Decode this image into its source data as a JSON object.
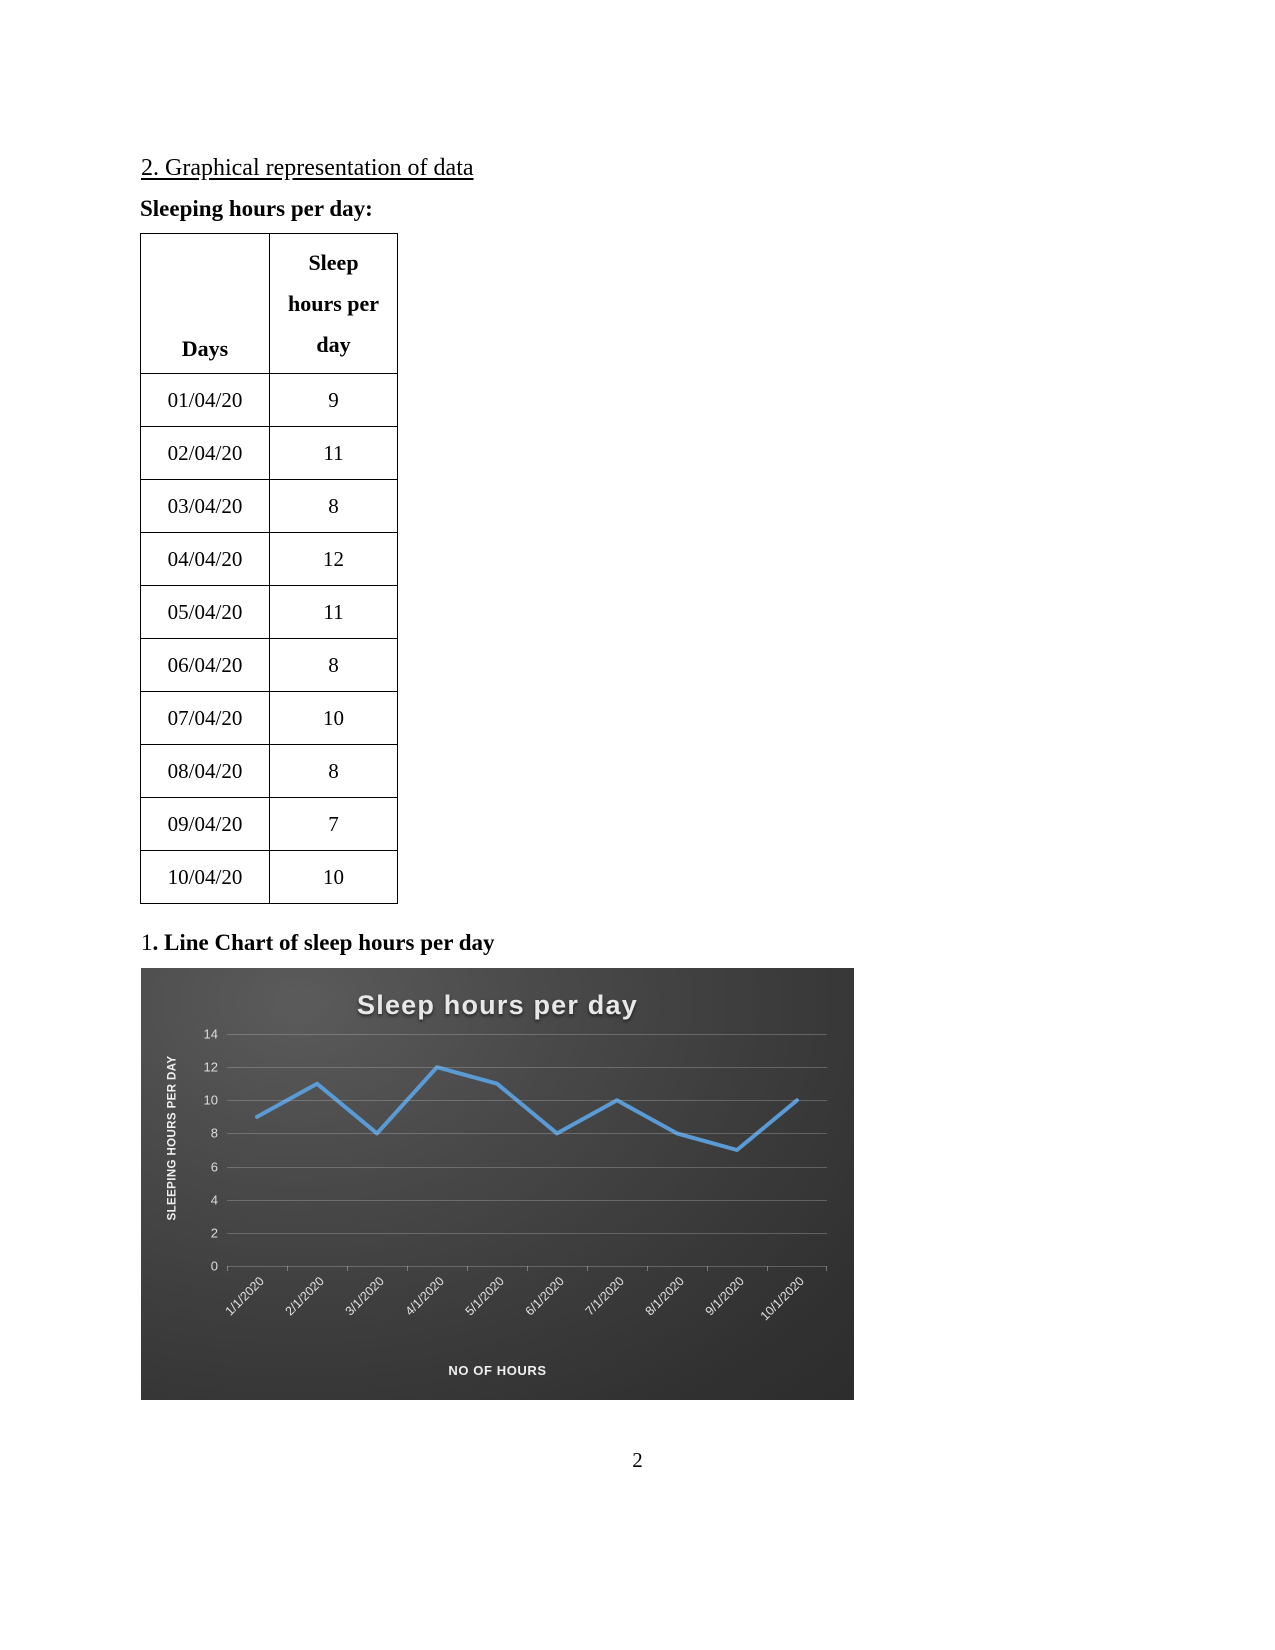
{
  "document": {
    "heading": "2. Graphical representation of data",
    "subheading": "Sleeping hours per day:",
    "page_number": "2"
  },
  "table": {
    "headers": [
      "Days",
      "Sleep hours per day"
    ],
    "header_days": "Days",
    "header_hours_line1": "Sleep",
    "header_hours_line2": "hours per",
    "header_hours_line3": "day",
    "rows": [
      {
        "day": "01/04/20",
        "hours": "9"
      },
      {
        "day": "02/04/20",
        "hours": "11"
      },
      {
        "day": "03/04/20",
        "hours": "8"
      },
      {
        "day": "04/04/20",
        "hours": "12"
      },
      {
        "day": "05/04/20",
        "hours": "11"
      },
      {
        "day": "06/04/20",
        "hours": "8"
      },
      {
        "day": "07/04/20",
        "hours": "10"
      },
      {
        "day": "08/04/20",
        "hours": "8"
      },
      {
        "day": "09/04/20",
        "hours": "7"
      },
      {
        "day": "10/04/20",
        "hours": "10"
      }
    ]
  },
  "chart_caption": {
    "number": "1",
    "text": ". Line Chart of sleep hours per day"
  },
  "chart_data": {
    "type": "line",
    "title": "Sleep hours per day",
    "xlabel": "NO OF HOURS",
    "ylabel": "SLEEPING HOURS PER DAY",
    "categories": [
      "1/1/2020",
      "2/1/2020",
      "3/1/2020",
      "4/1/2020",
      "5/1/2020",
      "6/1/2020",
      "7/1/2020",
      "8/1/2020",
      "9/1/2020",
      "10/1/2020"
    ],
    "values": [
      9,
      11,
      8,
      12,
      11,
      8,
      10,
      8,
      7,
      10
    ],
    "yticks": [
      14,
      12,
      10,
      8,
      6,
      4,
      2,
      0
    ],
    "ylim": [
      0,
      14
    ],
    "grid": true,
    "legend": "none",
    "line_color": "#5b9bd5",
    "background_color": "#3c3c3c",
    "text_color": "#e8e8e8"
  }
}
